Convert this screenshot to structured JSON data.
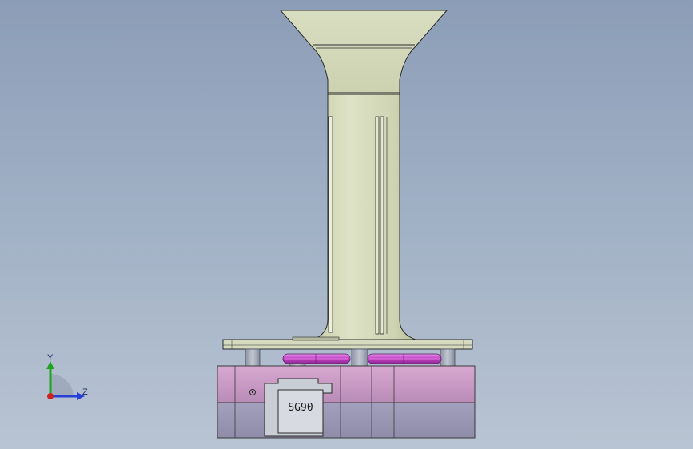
{
  "viewport": {
    "model": {
      "servo_label": "SG90"
    },
    "triad": {
      "y_label": "Y",
      "z_label": "Z"
    },
    "colors": {
      "background_top": "#8c9db7",
      "background_bottom": "#b9c4d3",
      "body_fill": "#d3d9b8",
      "body_edge": "#2a2a2a",
      "base_pink": "#c99ac3",
      "base_lower": "#9a97b6",
      "magenta_ring": "#d45ad6",
      "servo_fill": "#cfd2d9",
      "axis_y": "#1fa31f",
      "axis_z": "#2740d6",
      "axis_origin": "#cc2222"
    }
  }
}
